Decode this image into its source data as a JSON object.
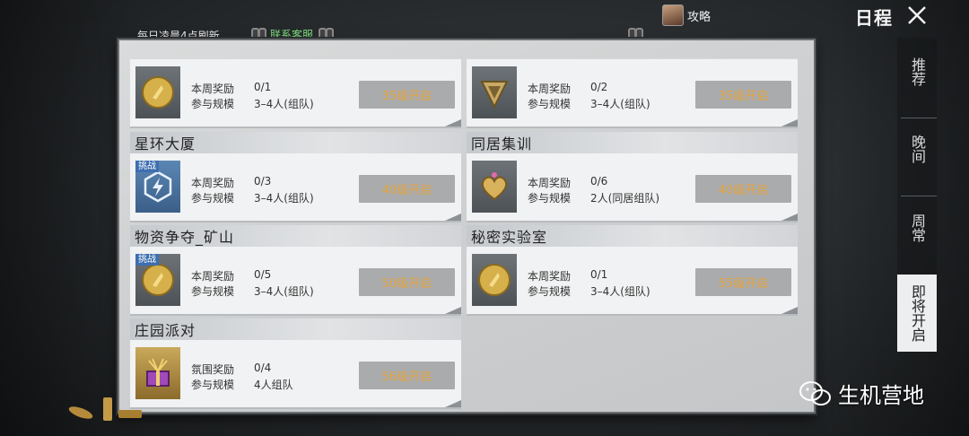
{
  "header": {
    "refresh_note": "每日凌晨4点刷新",
    "support_link": "联系客服",
    "guide_label": "攻略",
    "title": "日程"
  },
  "labels": {
    "reward": "本周奖励",
    "ambience_reward": "氛围奖励",
    "scale": "参与规模",
    "challenge": "挑战"
  },
  "cards": [
    {
      "title": "",
      "reward_label": "本周奖励",
      "reward": "0/1",
      "scale": "3–4人(组队)",
      "button": "35级开启",
      "icon": "gold-coin-icon"
    },
    {
      "title": "",
      "reward_label": "本周奖励",
      "reward": "0/2",
      "scale": "3–4人(组队)",
      "button": "35级开启",
      "icon": "emblem-icon"
    },
    {
      "title": "星环大厦",
      "reward_label": "本周奖励",
      "reward": "0/3",
      "scale": "3–4人(组队)",
      "button": "40级开启",
      "icon": "lightning-shield-icon",
      "challenge": "挑战"
    },
    {
      "title": "同居集训",
      "reward_label": "本周奖励",
      "reward": "0/6",
      "scale": "2人(同居组队)",
      "button": "40级开启",
      "icon": "heart-icon"
    },
    {
      "title": "物资争夺_矿山",
      "reward_label": "本周奖励",
      "reward": "0/5",
      "scale": "3–4人(组队)",
      "button": "50级开启",
      "icon": "gold-coin-icon",
      "challenge": "挑战"
    },
    {
      "title": "秘密实验室",
      "reward_label": "本周奖励",
      "reward": "0/1",
      "scale": "3–4人(组队)",
      "button": "55级开启",
      "icon": "gold-coin-icon"
    },
    {
      "title": "庄园派对",
      "reward_label": "氛围奖励",
      "reward": "0/4",
      "scale": "4人组队",
      "button": "56级开启",
      "icon": "gift-box-icon"
    }
  ],
  "side_nav": [
    {
      "label": "推荐"
    },
    {
      "label": "晚间"
    },
    {
      "label": "周常"
    },
    {
      "label": "即将开启",
      "active": true
    }
  ],
  "watermark": "生机营地",
  "colors": {
    "unlock_text": "#e6a33a",
    "support_link": "#7de07d",
    "challenge_tag": "#3d6fb0"
  }
}
